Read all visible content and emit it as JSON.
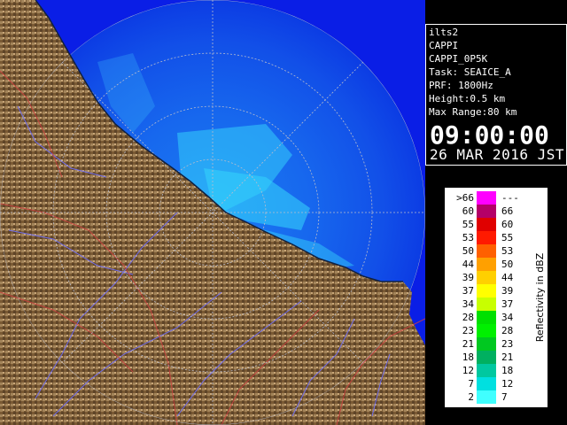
{
  "info": {
    "lines": [
      "ilts2",
      "CAPPI",
      "CAPPI_0P5K",
      "Task: SEAICE_A",
      "PRF: 1800Hz",
      "Height:0.5 km",
      "Max Range:80 km"
    ],
    "time": "09:00:00",
    "date": "26 MAR 2016 JST"
  },
  "legend": {
    "title": "Reflectivity in dBZ",
    "bins": [
      {
        "low": ">66",
        "high": "---",
        "color": "#ff00ff"
      },
      {
        "low": "60",
        "high": "66",
        "color": "#b40068"
      },
      {
        "low": "55",
        "high": "60",
        "color": "#e00000"
      },
      {
        "low": "53",
        "high": "55",
        "color": "#ff1a00"
      },
      {
        "low": "50",
        "high": "53",
        "color": "#ff6000"
      },
      {
        "low": "44",
        "high": "50",
        "color": "#ffa000"
      },
      {
        "low": "39",
        "high": "44",
        "color": "#ffd000"
      },
      {
        "low": "37",
        "high": "39",
        "color": "#ffff00"
      },
      {
        "low": "34",
        "high": "37",
        "color": "#c8ff00"
      },
      {
        "low": "28",
        "high": "34",
        "color": "#00e000"
      },
      {
        "low": "23",
        "high": "28",
        "color": "#00f000"
      },
      {
        "low": "21",
        "high": "23",
        "color": "#00c820"
      },
      {
        "low": "18",
        "high": "21",
        "color": "#00b060"
      },
      {
        "low": "12",
        "high": "18",
        "color": "#00c8a0"
      },
      {
        "low": "7",
        "high": "12",
        "color": "#00e0e0"
      },
      {
        "low": "2",
        "high": "7",
        "color": "#40ffff"
      }
    ]
  },
  "colors": {
    "sea_far": "#0a1ee6",
    "sea_near": "#1a78f0",
    "land": "#7a5a34",
    "land_light": "#b89468",
    "echo": "#3ef0ff",
    "range_ring": "#aab0c0",
    "river": "#7070ff",
    "boundary": "#d04040"
  }
}
